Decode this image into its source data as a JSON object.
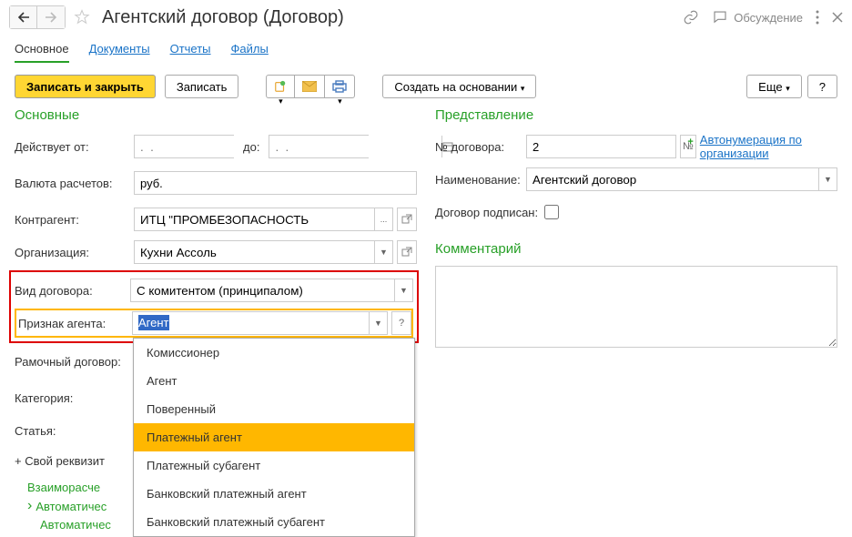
{
  "header": {
    "title": "Агентский договор (Договор)",
    "discuss": "Обсуждение"
  },
  "tabs": [
    "Основное",
    "Документы",
    "Отчеты",
    "Файлы"
  ],
  "toolbar": {
    "save_close": "Записать и закрыть",
    "save": "Записать",
    "create_based": "Создать на основании",
    "more": "Еще",
    "help": "?"
  },
  "sections": {
    "main": "Основные",
    "presentation": "Представление",
    "comment": "Комментарий"
  },
  "labels": {
    "active_from": "Действует от:",
    "to": "до:",
    "currency": "Валюта расчетов:",
    "counterparty": "Контрагент:",
    "organization": "Организация:",
    "contract_type": "Вид договора:",
    "agent_sign": "Признак агента:",
    "frame_contract": "Рамочный договор:",
    "category": "Категория:",
    "article": "Статья:",
    "own_attr": "+ Свой реквизит",
    "number": "№ договора:",
    "name": "Наименование:",
    "signed": "Договор подписан:",
    "autonum": "Автонумерация по организации"
  },
  "values": {
    "currency": "руб.",
    "counterparty": "ИТЦ \"ПРОМБЕЗОПАСНОСТЬ",
    "organization": "Кухни Ассоль",
    "contract_type": "С комитентом (принципалом)",
    "agent_sign": "Агент",
    "number": "2",
    "name": "Агентский договор",
    "date_placeholder": ".  .",
    "ellipsis": "..."
  },
  "dropdown": {
    "items": [
      "Комиссионер",
      "Агент",
      "Поверенный",
      "Платежный агент",
      "Платежный субагент",
      "Банковский платежный агент",
      "Банковский платежный субагент"
    ],
    "highlighted_index": 3
  },
  "expand": {
    "item1": "Взаиморасче",
    "item2": "Автоматичес",
    "item3": "Автоматичес"
  }
}
